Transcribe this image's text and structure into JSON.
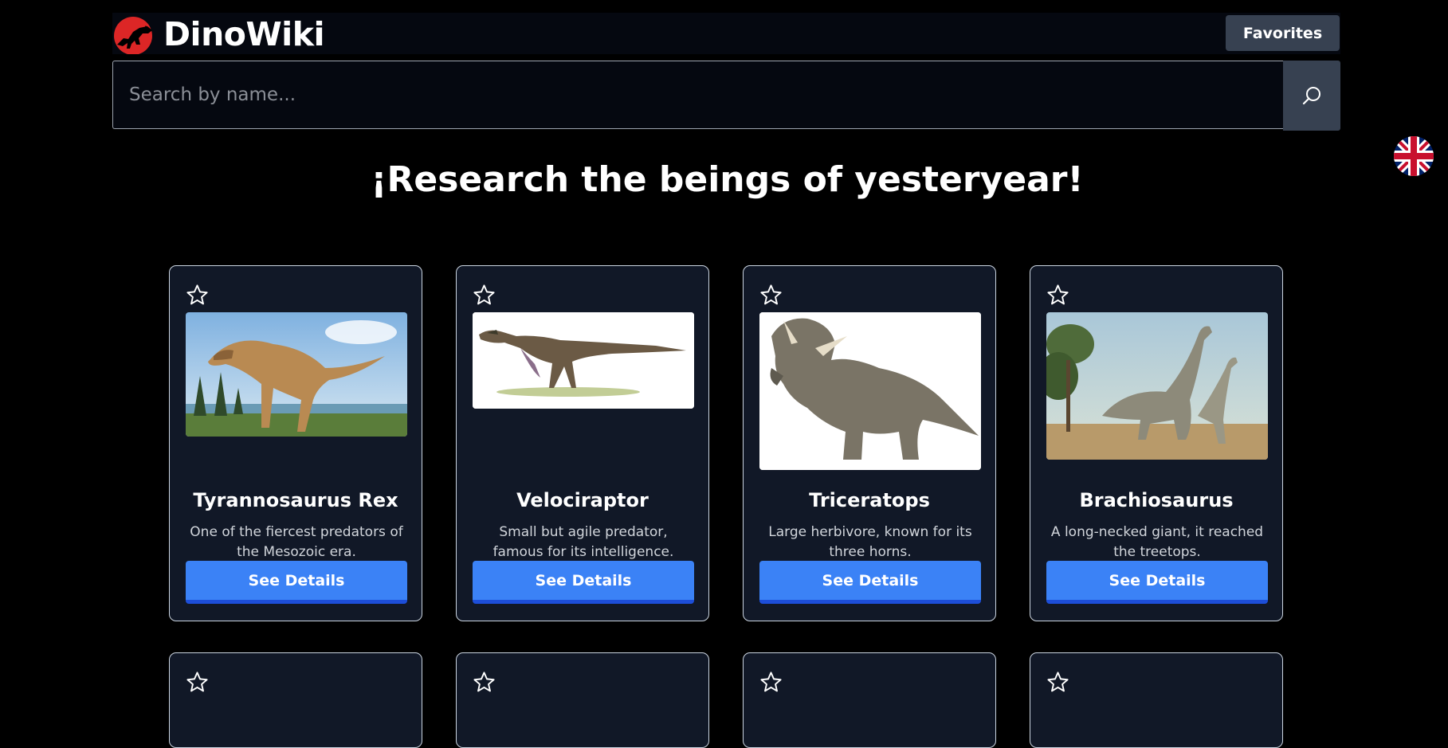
{
  "header": {
    "brand": "DinoWiki",
    "favorites_label": "Favorites"
  },
  "search": {
    "placeholder": "Search by name..."
  },
  "language": {
    "icon": "uk-flag-icon"
  },
  "headline": "¡Research the beings of yesteryear!",
  "cards": [
    {
      "title": "Tyrannosaurus Rex",
      "description": "One of the fiercest predators of the Mesozoic era.",
      "button": "See Details"
    },
    {
      "title": "Velociraptor",
      "description": "Small but agile predator, famous for its intelligence.",
      "button": "See Details"
    },
    {
      "title": "Triceratops",
      "description": "Large herbivore, known for its three horns.",
      "button": "See Details"
    },
    {
      "title": "Brachiosaurus",
      "description": "A long-necked giant, it reached the treetops.",
      "button": "See Details"
    }
  ],
  "colors": {
    "background": "#000000",
    "card": "#111827",
    "primary_button": "#3b82f6",
    "secondary_button": "#374151",
    "logo_red": "#dc2626"
  }
}
